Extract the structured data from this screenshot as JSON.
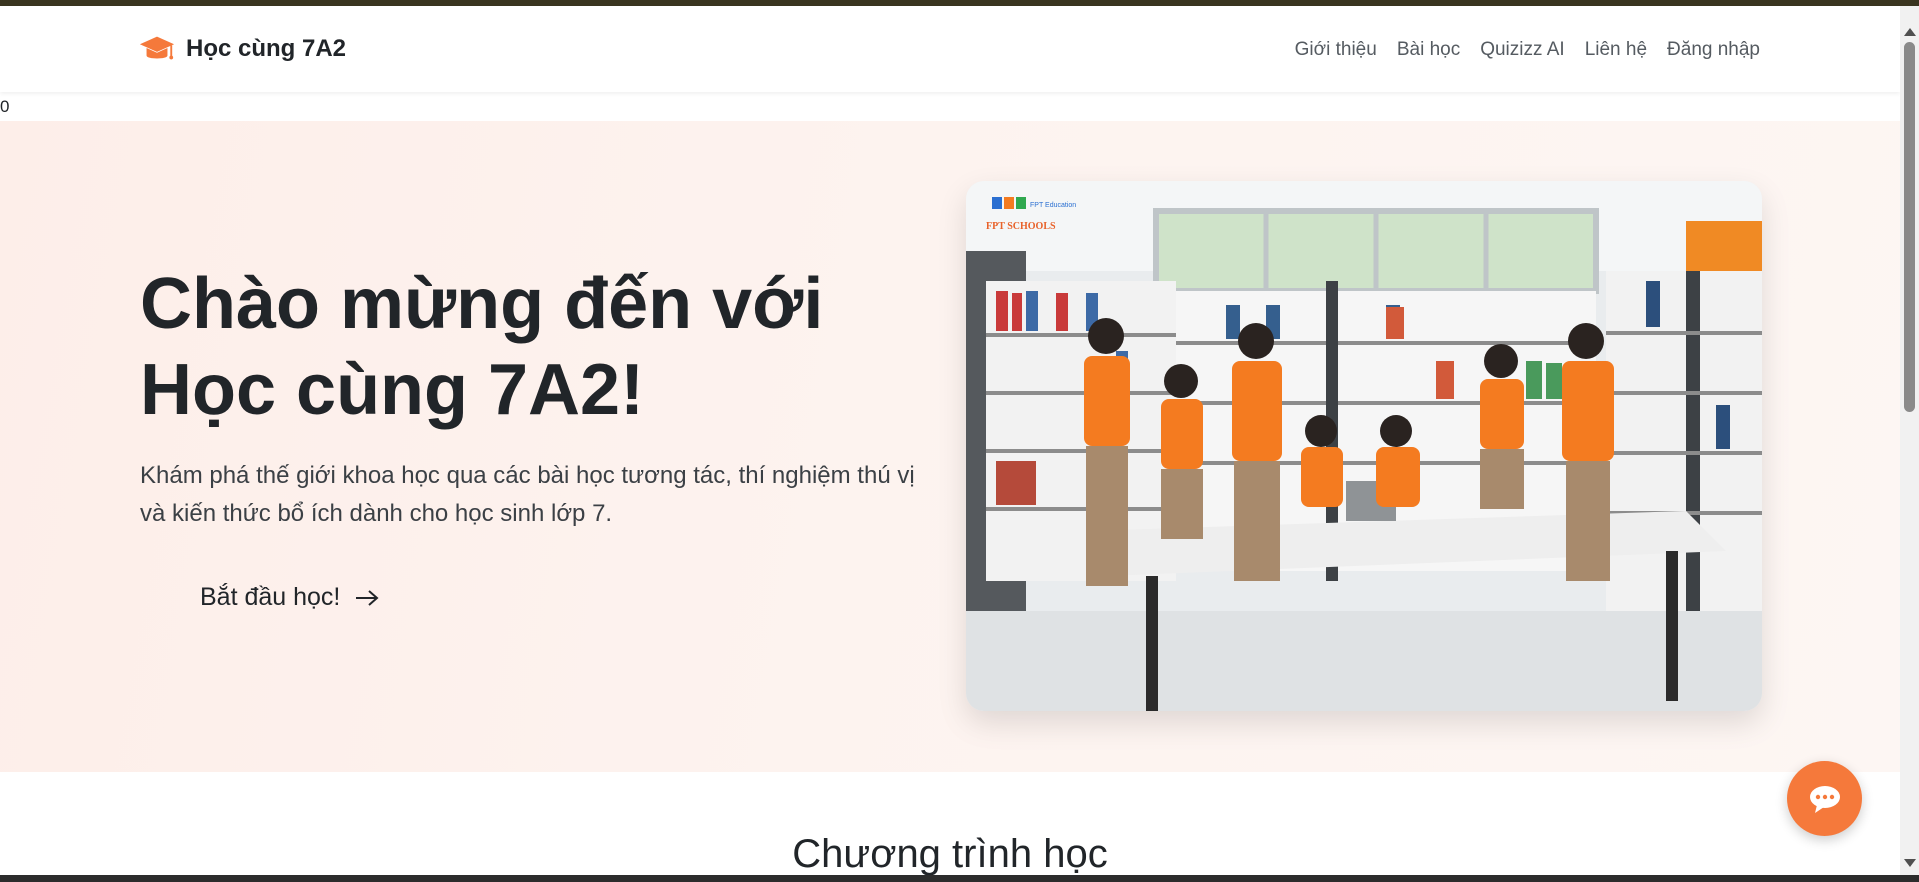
{
  "brand": {
    "name": "Học cùng 7A2",
    "icon": "graduation-cap-icon",
    "icon_color": "#f5793b"
  },
  "nav": {
    "items": [
      {
        "label": "Giới thiệu"
      },
      {
        "label": "Bài học"
      },
      {
        "label": "Quizizz AI"
      },
      {
        "label": "Liên hệ"
      },
      {
        "label": "Đăng nhập"
      }
    ]
  },
  "stray_text": "0",
  "hero": {
    "title_line1": "Chào mừng đến với",
    "title_line2": "Học cùng 7A2!",
    "subtitle": "Khám phá thế giới khoa học qua các bài học tương tác, thí nghiệm thú vị và kiến thức bổ ích dành cho học sinh lớp 7.",
    "cta_label": "Bắt đầu học!",
    "cta_icon": "arrow-right-icon",
    "image_logo_line1": "FPT Education",
    "image_logo_line2": "FPT SCHOOLS"
  },
  "section": {
    "title": "Chương trình học"
  },
  "chat": {
    "icon": "chat-bubble-icon",
    "color": "#f5793b"
  },
  "colors": {
    "accent": "#f5793b",
    "hero_bg": "#fdeee9",
    "text": "#212529"
  }
}
